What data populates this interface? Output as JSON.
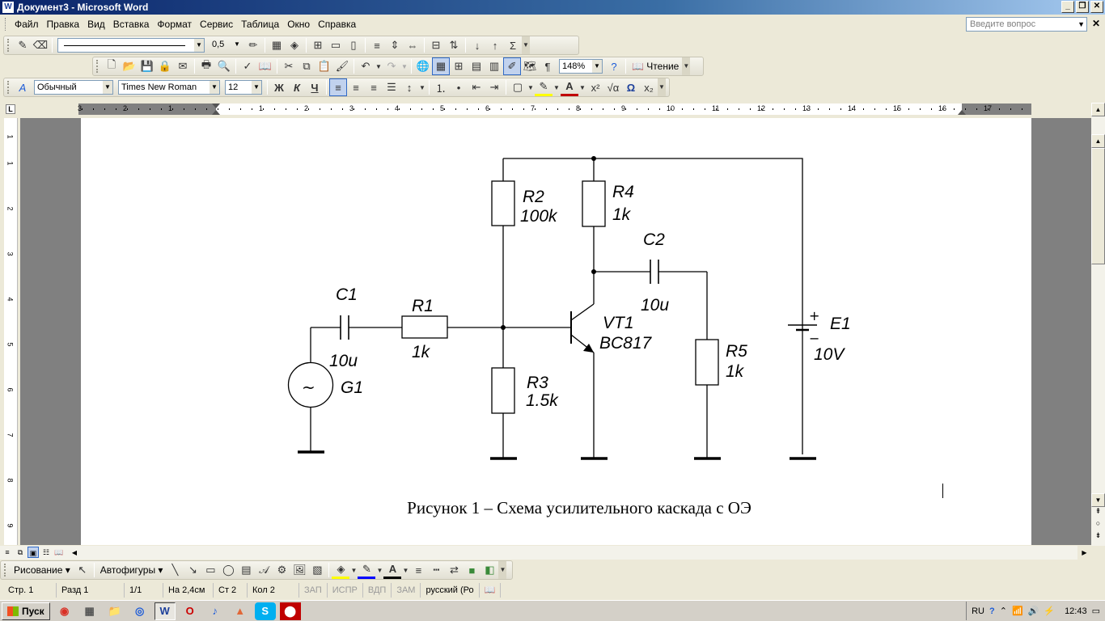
{
  "window": {
    "title": "Документ3 - Microsoft Word",
    "app_icon": "W",
    "minimize": "_",
    "restore": "❐",
    "close": "✕"
  },
  "menu": {
    "items": [
      "Файл",
      "Правка",
      "Вид",
      "Вставка",
      "Формат",
      "Сервис",
      "Таблица",
      "Окно",
      "Справка"
    ],
    "help_placeholder": "Введите вопрос",
    "doc_close": "✕"
  },
  "toolbar1": {
    "line_weight": "0,5"
  },
  "toolbar2": {
    "zoom": "148%",
    "reading_label": "Чтение"
  },
  "format_bar": {
    "style": "Обычный",
    "font": "Times New Roman",
    "size": "12",
    "bold": "Ж",
    "italic": "К",
    "underline": "Ч"
  },
  "ruler": {
    "tab_selector": "L",
    "numbers_left": [
      "3",
      "2",
      "1"
    ],
    "numbers_right": [
      "1",
      "2",
      "3",
      "4",
      "5",
      "6",
      "7",
      "8",
      "9",
      "10",
      "11",
      "12",
      "13",
      "14",
      "15",
      "16",
      "17"
    ],
    "vertical_numbers": [
      "1",
      "1",
      "2",
      "3",
      "4",
      "5",
      "6",
      "7",
      "8",
      "9"
    ]
  },
  "schematic": {
    "components": {
      "R2": {
        "name": "R2",
        "value": "100k"
      },
      "R4": {
        "name": "R4",
        "value": "1k"
      },
      "C2": {
        "name": "C2",
        "value": "10u"
      },
      "C1": {
        "name": "C1",
        "value": "10u"
      },
      "R1": {
        "name": "R1",
        "value": "1k"
      },
      "VT1": {
        "name": "VT1",
        "value": "BC817"
      },
      "R3": {
        "name": "R3",
        "value": "1.5k"
      },
      "R5": {
        "name": "R5",
        "value": "1k"
      },
      "G1": {
        "name": "G1",
        "symbol": "~"
      },
      "E1": {
        "name": "E1",
        "value": "10V",
        "plus": "+",
        "minus": "−"
      }
    }
  },
  "caption": "Рисунок 1 – Схема усилительного каскада с ОЭ",
  "drawing_toolbar": {
    "draw_label": "Рисование",
    "autoshapes_label": "Автофигуры"
  },
  "statusbar": {
    "page": "Стр. 1",
    "section": "Разд 1",
    "pages": "1/1",
    "at": "На 2,4см",
    "line": "Ст 2",
    "col": "Кол 2",
    "rec": "ЗАП",
    "trk": "ИСПР",
    "ext": "ВДП",
    "ovr": "ЗАМ",
    "language": "русский (Ро"
  },
  "taskbar": {
    "start_label": "Пуск",
    "lang": "RU",
    "clock": "12:43"
  }
}
